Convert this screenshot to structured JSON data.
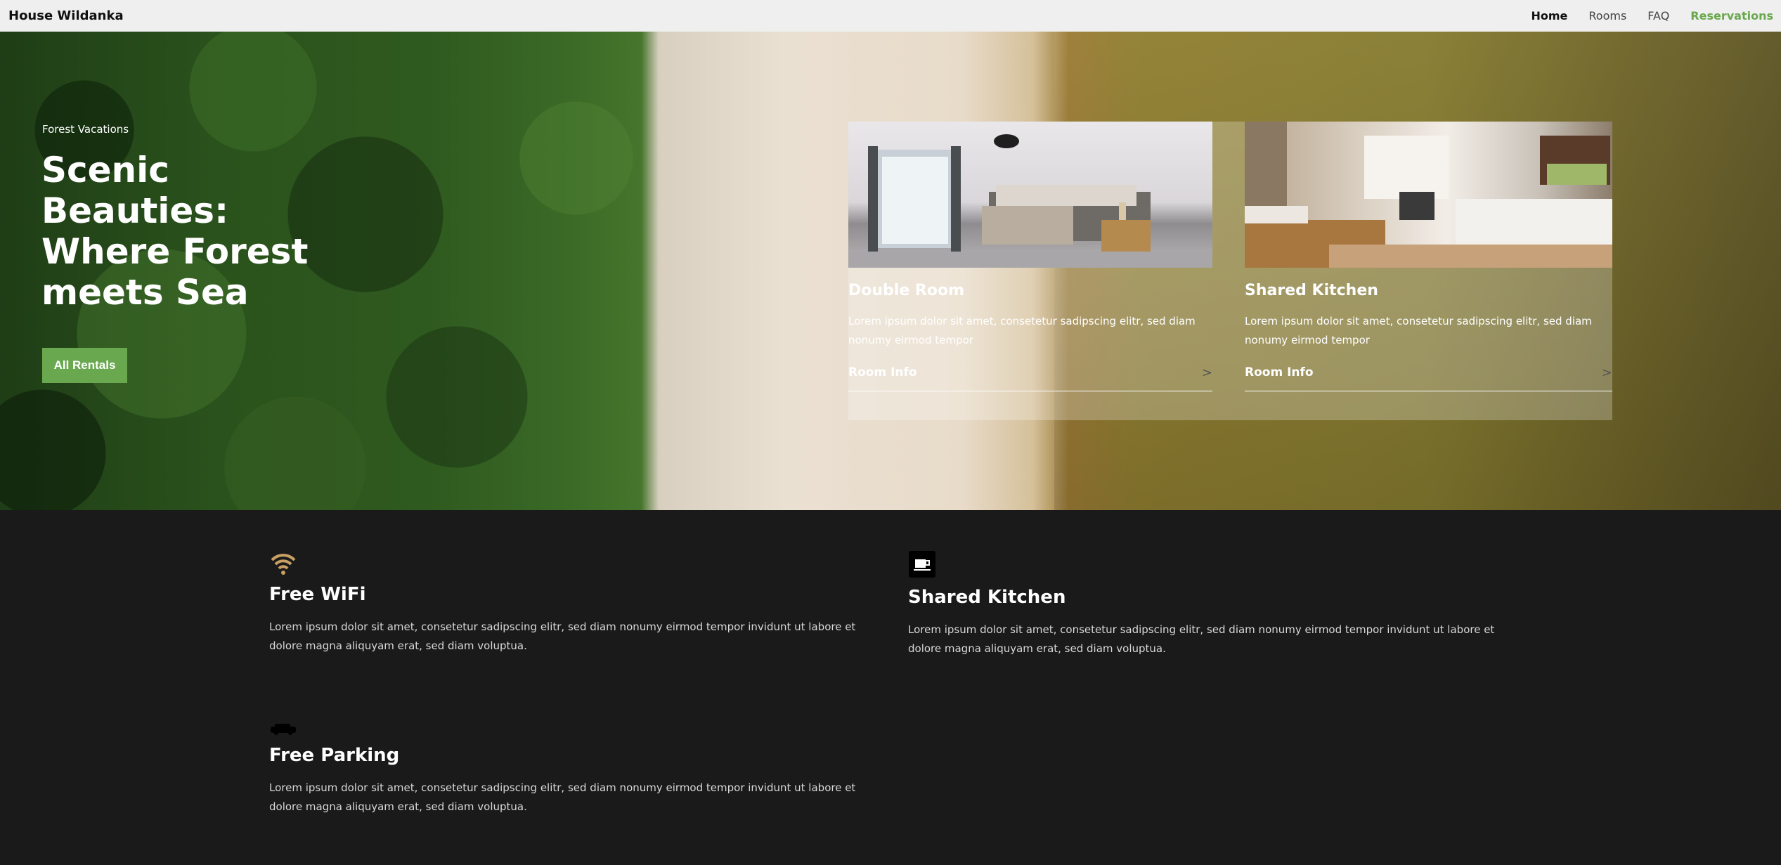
{
  "nav": {
    "brand": "House Wildanka",
    "links": [
      "Home",
      "Rooms",
      "FAQ",
      "Reservations"
    ]
  },
  "hero": {
    "kicker": "Forest Vacations",
    "title": "Scenic Beauties: Where Forest meets Sea",
    "button": "All Rentals"
  },
  "cards": [
    {
      "title": "Double Room",
      "text": "Lorem ipsum dolor sit amet, consetetur sadipscing elitr, sed diam nonumy eirmod tempor",
      "link": "Room Info",
      "image": "bedroom-photo"
    },
    {
      "title": "Shared Kitchen",
      "text": "Lorem ipsum dolor sit amet, consetetur sadipscing elitr, sed diam nonumy eirmod tempor",
      "link": "Room Info",
      "image": "kitchen-photo"
    }
  ],
  "features": [
    {
      "icon": "wifi-icon",
      "title": "Free WiFi",
      "text": "Lorem ipsum dolor sit amet, consetetur sadipscing elitr, sed diam nonumy eirmod tempor invidunt ut labore et dolore magna aliquyam erat, sed diam voluptua."
    },
    {
      "icon": "coffee-cup-icon",
      "title": "Shared Kitchen",
      "text": "Lorem ipsum dolor sit amet, consetetur sadipscing elitr, sed diam nonumy eirmod tempor invidunt ut labore et dolore magna aliquyam erat, sed diam voluptua."
    },
    {
      "icon": "car-icon",
      "title": "Free Parking",
      "text": "Lorem ipsum dolor sit amet, consetetur sadipscing elitr, sed diam nonumy eirmod tempor invidunt ut labore et dolore magna aliquyam erat, sed diam voluptua."
    }
  ],
  "colors": {
    "accent": "#6aa84f",
    "dark": "#1a1a1a",
    "wifi_gold": "#c9a063"
  }
}
